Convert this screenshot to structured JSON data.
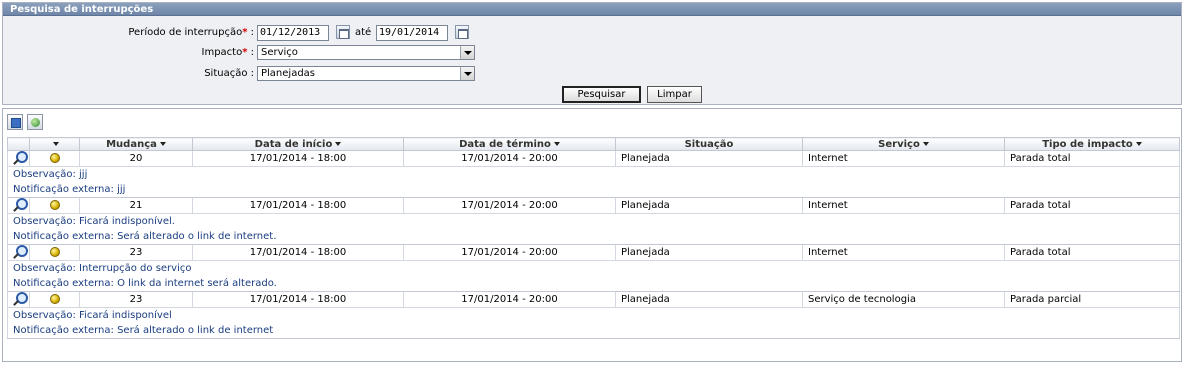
{
  "panel": {
    "title": "Pesquisa de interrupções"
  },
  "form": {
    "period_label": "Período de interrupção",
    "period_required": "*",
    "period_colon": " :",
    "start_date": "01/12/2013",
    "until_label": "até",
    "end_date": "19/01/2014",
    "impact_label": "Impacto",
    "impact_required": "*",
    "impact_colon": " :",
    "impact_value": "Serviço",
    "status_label": "Situação :",
    "status_value": "Planejadas",
    "search_button": "Pesquisar",
    "clear_button": "Limpar"
  },
  "toolbar": {
    "icons": [
      "export-icon",
      "refresh-icon"
    ]
  },
  "table": {
    "headers": {
      "status": "",
      "change": "Mudança",
      "start": "Data de início",
      "end": "Data de término",
      "situation": "Situação",
      "service": "Serviço",
      "impact_type": "Tipo de impacto"
    },
    "rows": [
      {
        "change": "20",
        "start": "17/01/2014 - 18:00",
        "end": "17/01/2014 - 20:00",
        "situation": "Planejada",
        "service": "Internet",
        "impact_type": "Parada total",
        "observation": "Observação: jjj",
        "notification": "Notificação externa: jjj"
      },
      {
        "change": "21",
        "start": "17/01/2014 - 18:00",
        "end": "17/01/2014 - 20:00",
        "situation": "Planejada",
        "service": "Internet",
        "impact_type": "Parada total",
        "observation": "Observação: Ficará indisponível.",
        "notification": "Notificação externa: Será alterado o link de internet."
      },
      {
        "change": "23",
        "start": "17/01/2014 - 18:00",
        "end": "17/01/2014 - 20:00",
        "situation": "Planejada",
        "service": "Internet",
        "impact_type": "Parada total",
        "observation": "Observação: Interrupção do serviço",
        "notification": "Notificação externa: O link da internet será alterado."
      },
      {
        "change": "23",
        "start": "17/01/2014 - 18:00",
        "end": "17/01/2014 - 20:00",
        "situation": "Planejada",
        "service": "Serviço de tecnologia",
        "impact_type": "Parada parcial",
        "observation": "Observação: Ficará indisponível",
        "notification": "Notificação externa: Será alterado o link de internet"
      }
    ]
  },
  "colors": {
    "title_bar": "#7a90b2",
    "panel_bg": "#eef0f4",
    "note_text": "#1a3d80",
    "required": "#d00000",
    "status_dot": "#d6b000"
  }
}
